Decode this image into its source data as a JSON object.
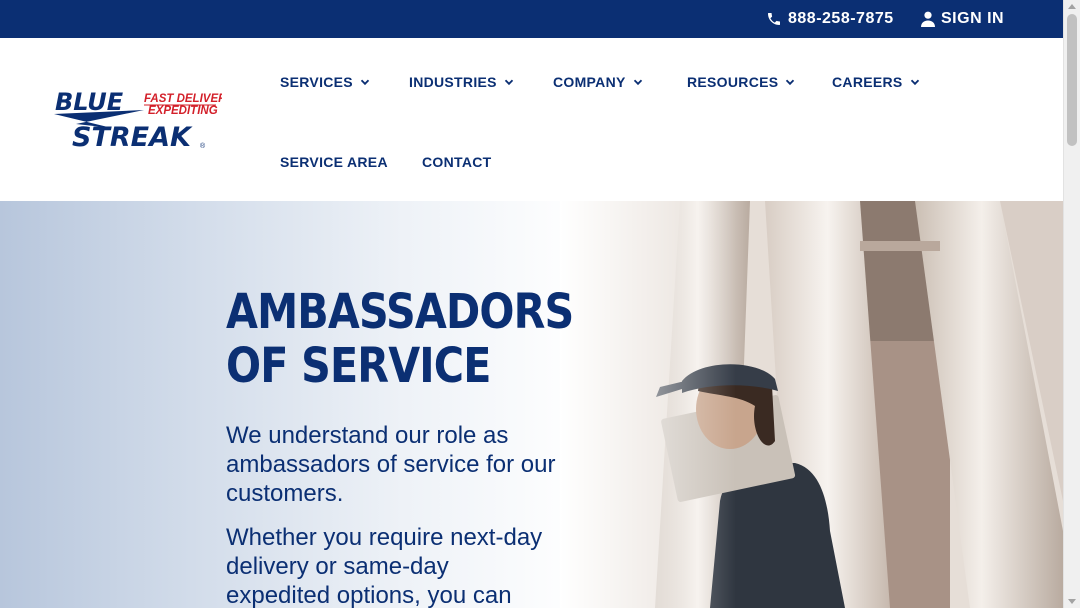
{
  "topbar": {
    "phone": "888-258-7875",
    "signin": "SIGN IN",
    "phone_icon": "phone-icon",
    "user_icon": "user-icon"
  },
  "brand": {
    "line1": "BLUE",
    "line2": "STREAK",
    "tag1": "FAST DELIVERY",
    "tag2": "EXPEDITING",
    "registered": "®"
  },
  "nav": {
    "services": "SERVICES",
    "industries": "INDUSTRIES",
    "company": "COMPANY",
    "resources": "RESOURCES",
    "careers": "CAREERS",
    "service_area": "SERVICE AREA",
    "contact": "CONTACT"
  },
  "hero": {
    "title_line1": "AMBASSADORS",
    "title_line2": "OF SERVICE",
    "p1": "We understand our role as ambassadors of service for our customers.",
    "p2": "Whether you require next-day delivery or same-day expedited options, you can"
  },
  "colors": {
    "brand_navy": "#0b2f73",
    "brand_red": "#d3202a"
  }
}
